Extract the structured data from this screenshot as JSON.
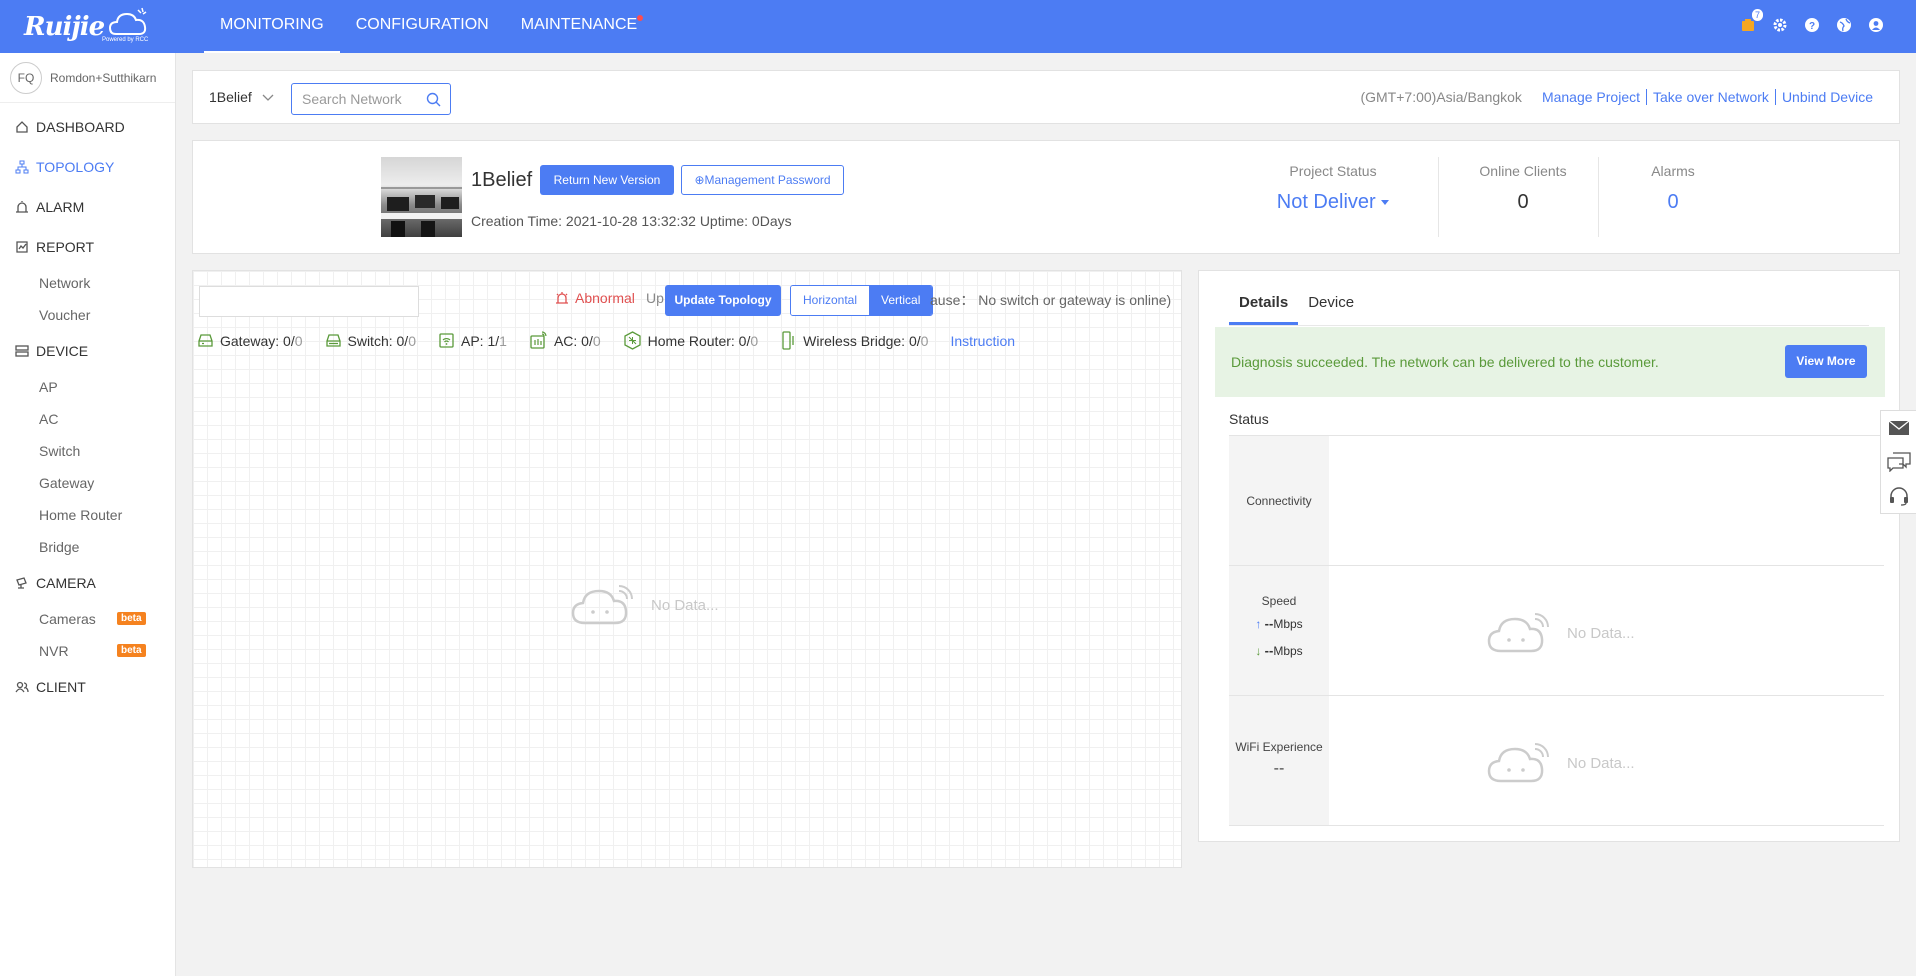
{
  "app": {
    "logo_text": "Ruijie",
    "logo_sub": "Powered by RCC"
  },
  "nav": {
    "items": [
      {
        "label": "MONITORING",
        "active": true
      },
      {
        "label": "CONFIGURATION",
        "active": false
      },
      {
        "label": "MAINTENANCE",
        "active": false,
        "dot": true
      }
    ]
  },
  "top_icons": {
    "notification_count": "7",
    "icons": [
      "notification-icon",
      "gear-icon",
      "help-icon",
      "globe-icon",
      "user-icon"
    ]
  },
  "sidebar": {
    "user": {
      "avatar": "FQ",
      "name": "Romdon+Sutthikarn"
    },
    "menu": {
      "dashboard": "DASHBOARD",
      "topology": "TOPOLOGY",
      "alarm": "ALARM",
      "report": "REPORT",
      "report_network": "Network",
      "report_voucher": "Voucher",
      "device": "DEVICE",
      "device_ap": "AP",
      "device_ac": "AC",
      "device_switch": "Switch",
      "device_gateway": "Gateway",
      "device_home_router": "Home Router",
      "device_bridge": "Bridge",
      "camera": "CAMERA",
      "camera_cameras": "Cameras",
      "camera_nvr": "NVR",
      "beta": "beta",
      "client": "CLIENT"
    }
  },
  "header": {
    "project": "1Belief",
    "search_placeholder": "Search Network",
    "timezone": "(GMT+7:00)Asia/Bangkok",
    "manage_project": "Manage Project",
    "take_over": "Take over Network",
    "unbind": "Unbind Device"
  },
  "project": {
    "name": "1Belief",
    "return_btn": "Return New Version",
    "mgmt_btn": "⊕Management Password",
    "created": "Creation Time: 2021-10-28 13:32:32 Uptime: 0Days",
    "status_label": "Project Status",
    "status_value": "Not Deliver",
    "clients_label": "Online Clients",
    "clients_value": "0",
    "alarms_label": "Alarms",
    "alarms_value": "0"
  },
  "topology": {
    "abnormal": "Abnormal",
    "update_text_partial": "Up",
    "update_btn": "Update Topology",
    "horizontal": "Horizontal",
    "vertical": "Vertical",
    "cause": "ause：  No switch or gateway is online)",
    "devices": [
      {
        "label": "Gateway: 0/",
        "total": "0"
      },
      {
        "label": "Switch: 0/",
        "total": "0"
      },
      {
        "label": "AP: 1/",
        "total": "1"
      },
      {
        "label": "AC: 0/",
        "total": "0"
      },
      {
        "label": "Home Router: 0/",
        "total": "0"
      },
      {
        "label": "Wireless Bridge: 0/",
        "total": "0"
      }
    ],
    "instruction": "Instruction",
    "nodata": "No Data..."
  },
  "details": {
    "tab_details": "Details",
    "tab_device": "Device",
    "diag_text": "Diagnosis succeeded. The network can be delivered to the customer.",
    "view_more": "View More",
    "status_title": "Status",
    "connectivity": "Connectivity",
    "speed": "Speed",
    "up_value": "--",
    "down_value": "--",
    "speed_unit": "Mbps",
    "wifi": "WiFi Experience",
    "wifi_value": "--",
    "nodata": "No Data..."
  },
  "colors": {
    "primary": "#4c7cf3",
    "abnormal": "#e05050",
    "success_bg": "#e7f3e4",
    "success_text": "#5a9a3a",
    "beta": "#f5821f"
  }
}
